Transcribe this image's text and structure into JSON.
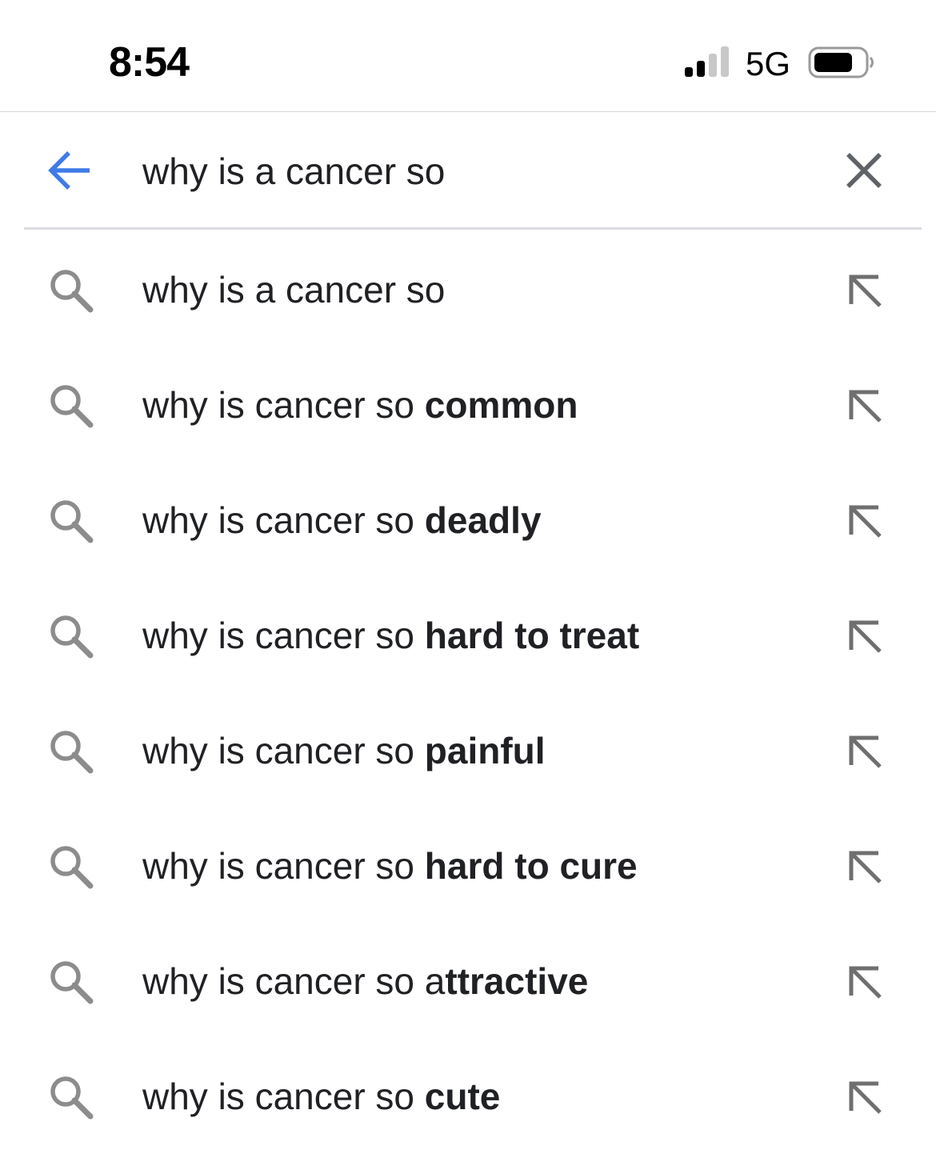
{
  "status_bar": {
    "time": "8:54",
    "network": "5G",
    "signal_bars_filled": 2,
    "signal_bars_total": 4,
    "battery_level": 0.75
  },
  "search": {
    "query": "why is a cancer so",
    "back_icon": "arrow-left-icon",
    "clear_icon": "close-icon"
  },
  "colors": {
    "accent_blue": "#3f7be8",
    "text": "#202124",
    "icon_gray": "#70757a"
  },
  "suggestions": [
    {
      "prefix": "why is a cancer so",
      "completion": ""
    },
    {
      "prefix": "why is cancer so ",
      "completion": "common"
    },
    {
      "prefix": "why is cancer so ",
      "completion": "deadly"
    },
    {
      "prefix": "why is cancer so ",
      "completion": "hard to treat"
    },
    {
      "prefix": "why is cancer so ",
      "completion": "painful"
    },
    {
      "prefix": "why is cancer so ",
      "completion": "hard to cure"
    },
    {
      "prefix": "why is cancer so a",
      "completion": "ttractive"
    },
    {
      "prefix": "why is cancer so ",
      "completion": "cute"
    }
  ]
}
